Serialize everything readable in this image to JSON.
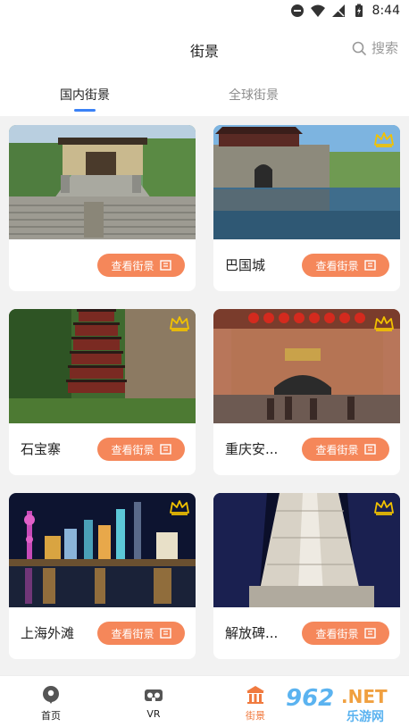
{
  "status": {
    "time": "8:44"
  },
  "header": {
    "title": "街景",
    "search_label": "搜索"
  },
  "tabs": [
    {
      "label": "国内街景",
      "active": true
    },
    {
      "label": "全球街景",
      "active": false
    }
  ],
  "cards": [
    {
      "name": "",
      "button": "查看街景",
      "vip": false
    },
    {
      "name": "巴国城",
      "button": "查看街景",
      "vip": true
    },
    {
      "name": "石宝寨",
      "button": "查看街景",
      "vip": true
    },
    {
      "name": "重庆安...",
      "button": "查看街景",
      "vip": true
    },
    {
      "name": "上海外滩",
      "button": "查看街景",
      "vip": true
    },
    {
      "name": "解放碑...",
      "button": "查看街景",
      "vip": true
    }
  ],
  "bottom_nav": [
    {
      "label": "首页",
      "icon": "location-pin-icon",
      "active": false
    },
    {
      "label": "VR",
      "icon": "vr-headset-icon",
      "active": false
    },
    {
      "label": "街景",
      "icon": "temple-icon",
      "active": true
    }
  ],
  "watermark": {
    "number": "962",
    "suffix": ".NET",
    "text": "乐游网"
  },
  "colors": {
    "accent": "#f5875a",
    "tab_indicator": "#3b82f6",
    "crown": "#f2c200",
    "nav_active": "#f07a3f"
  }
}
